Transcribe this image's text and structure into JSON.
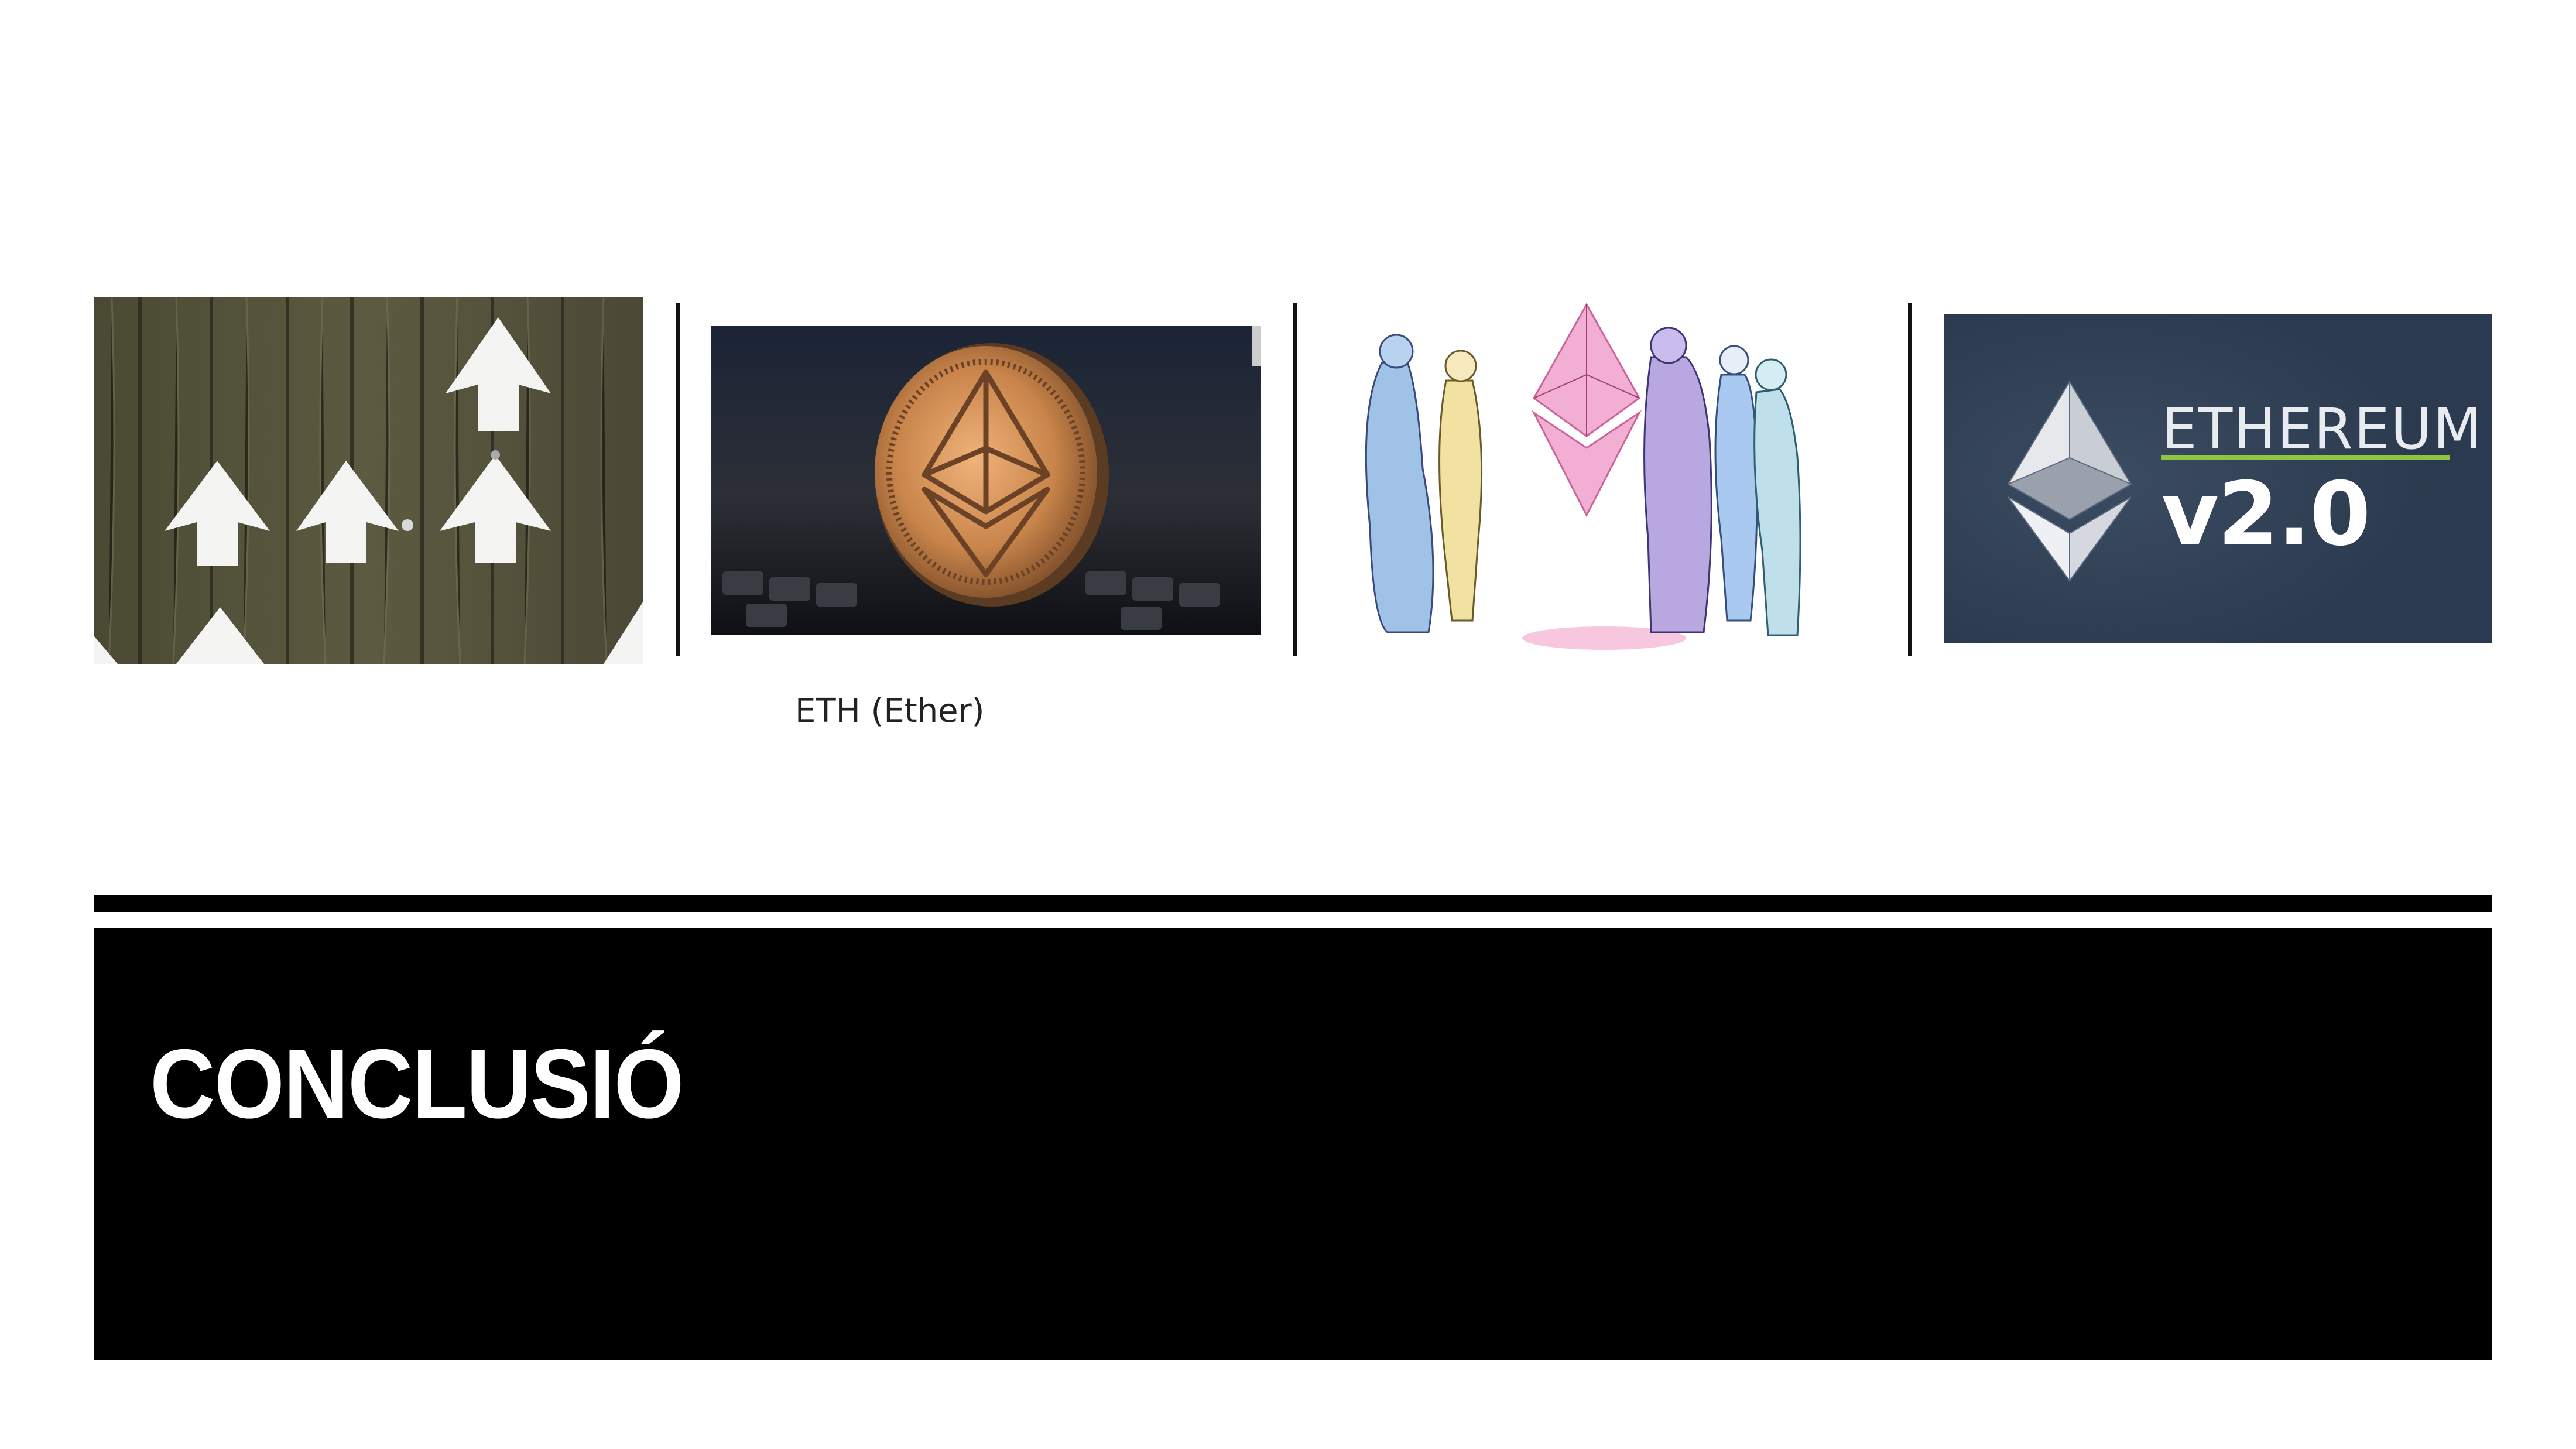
{
  "gallery": {
    "images": [
      {
        "name": "arrows-on-wood",
        "icon": "up-arrows-photo"
      },
      {
        "name": "ether-coin",
        "icon": "ethereum-coin-photo"
      },
      {
        "name": "ethereum-illustration",
        "icon": "people-around-ethereum-crystal"
      },
      {
        "name": "ethereum-v2-logo",
        "icon": "ethereum-logo",
        "logo_word": "ETHEREUM",
        "logo_version": "v2.0"
      }
    ],
    "caption": "ETH (Ether)"
  },
  "slide": {
    "title": "CONCLUSIÓ"
  },
  "colors": {
    "title_band": "#000000",
    "title_text": "#ffffff",
    "logo_bg": "#2f3e52",
    "logo_accent": "#8ec63f",
    "illustration_pink": "#f2a6cf"
  }
}
